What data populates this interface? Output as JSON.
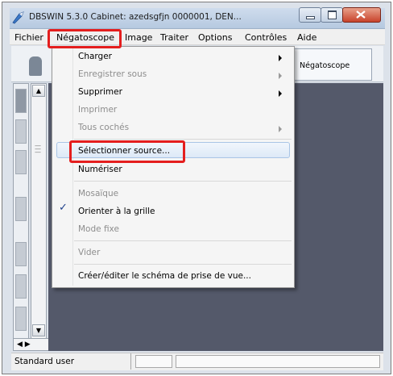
{
  "window": {
    "title": "DBSWIN 5.3.0      Cabinet: azedsgfjn      0000001, DEN..."
  },
  "menubar": {
    "items": [
      "Fichier",
      "Négatoscope",
      "Image",
      "Traiter",
      "Options",
      "Contrôles",
      "Aide"
    ]
  },
  "toolbar": {
    "negatoscope_label": "Négatoscope"
  },
  "dropdown": {
    "items": [
      {
        "label": "Charger",
        "disabled": false,
        "submenu": true
      },
      {
        "label": "Enregistrer sous",
        "disabled": true,
        "submenu": true
      },
      {
        "label": "Supprimer",
        "disabled": false,
        "submenu": true
      },
      {
        "label": "Imprimer",
        "disabled": true,
        "submenu": false
      },
      {
        "label": "Tous cochés",
        "disabled": true,
        "submenu": true
      },
      {
        "label": "Sélectionner source...",
        "disabled": false,
        "submenu": false,
        "highlighted": true
      },
      {
        "label": "Numériser",
        "disabled": false,
        "submenu": false
      },
      {
        "label": "Mosaïque",
        "disabled": true,
        "submenu": false
      },
      {
        "label": "Orienter à la grille",
        "disabled": false,
        "submenu": false,
        "checked": true
      },
      {
        "label": "Mode fixe",
        "disabled": true,
        "submenu": false
      },
      {
        "label": "Vider",
        "disabled": true,
        "submenu": false
      },
      {
        "label": "Créer/éditer le schéma de prise de vue...",
        "disabled": false,
        "submenu": false
      }
    ]
  },
  "checkmark": "✓",
  "statusbar": {
    "user": "Standard user"
  },
  "colors": {
    "callout": "#e41e1e",
    "workspace": "#54596a"
  }
}
